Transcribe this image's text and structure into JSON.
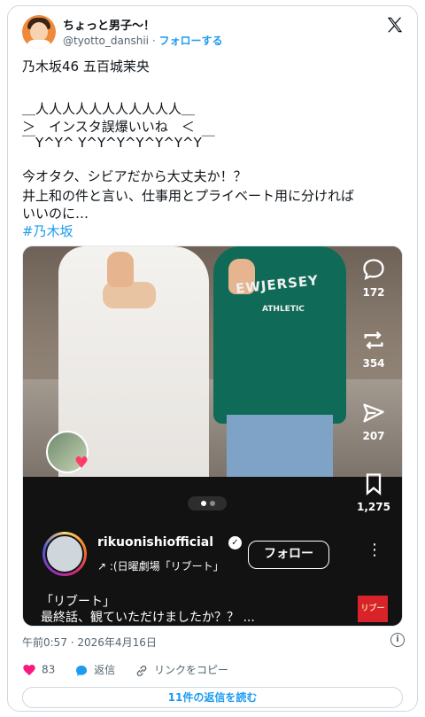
{
  "author": {
    "display_name": "ちょっと男子〜！",
    "handle": "@tyotto_danshii",
    "separator": "·",
    "follow_label": "フォローする"
  },
  "tweet": {
    "line1": "乃木坂46 五百城茉央",
    "aa_line1": "＿人人人人人人人人人人人＿",
    "aa_line2": "＞　インスタ誤爆いいね　＜",
    "aa_line3": "￣Y^Y^ Y^Y^Y^Y^Y^Y^Y￣",
    "body1": "今オタク、シビアだから大丈夫か！？",
    "body2": "井上和の件と言い、仕事用とプライベート用に分ければ",
    "body3": "いいのに…",
    "hashtag": "#乃木坂"
  },
  "embed": {
    "shirt_text": "EWJERSEY",
    "shirt_sub": "ATHLETIC",
    "likes": "172",
    "reposts": "354",
    "shares": "207",
    "saves": "1,275",
    "username": "rikuonishiofficial",
    "verified_mark": "✓",
    "sub_line": "↗ :(日曜劇場「リブート」",
    "follow_label": "フォロー",
    "caption_line1": "「リブート」",
    "caption_line2": "最終話、観ていただけましたか？？ ...",
    "thumb_text": "リブート",
    "kebab": "⋮"
  },
  "footer": {
    "timestamp": "午前0:57 · 2026年4月16日",
    "like_count": "83",
    "reply_label": "返信",
    "copy_link_label": "リンクをコピー",
    "read_replies_label": "11件の返信を読む"
  },
  "colors": {
    "accent": "#1d9bf0",
    "like": "#f91880",
    "text": "#0f1419",
    "muted": "#536471",
    "border": "#cfd9de"
  },
  "icons": {
    "header": [
      "x-logo-icon"
    ],
    "embed": [
      "comment-icon",
      "repost-icon",
      "share-icon",
      "bookmark-icon"
    ],
    "footer": [
      "heart-icon",
      "reply-icon",
      "link-icon",
      "info-icon"
    ]
  }
}
